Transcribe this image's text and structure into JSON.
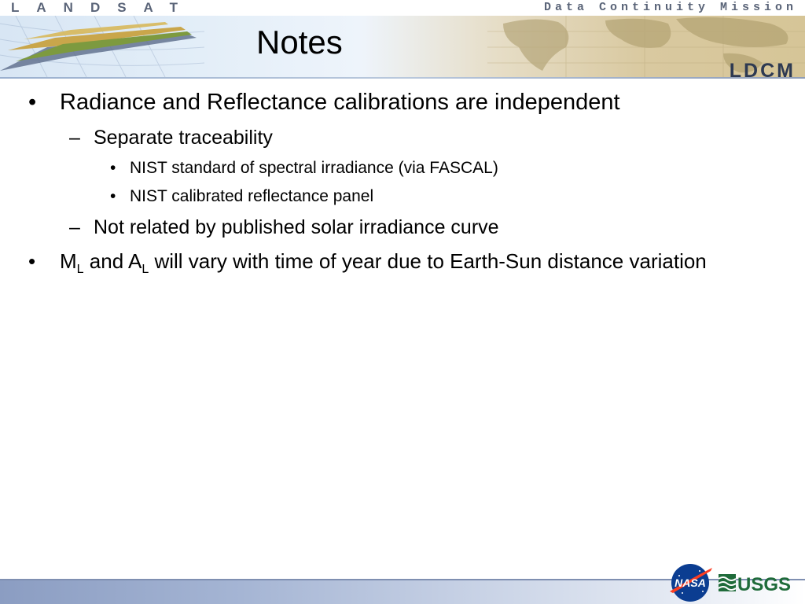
{
  "header": {
    "brand_left": "LANDSAT",
    "brand_right": "Data Continuity Mission",
    "program_logo_text": "LDCM"
  },
  "slide": {
    "title": "Notes",
    "items": [
      {
        "level": 1,
        "bullet": "•",
        "text": "Radiance and Reflectance calibrations are independent"
      },
      {
        "level": 2,
        "bullet": "–",
        "text": "Separate traceability"
      },
      {
        "level": 3,
        "bullet": "•",
        "text": "NIST standard of spectral irradiance (via FASCAL)"
      },
      {
        "level": 3,
        "bullet": "•",
        "text": "NIST calibrated reflectance panel"
      },
      {
        "level": 2,
        "bullet": "–",
        "text": "Not related by published solar irradiance curve"
      },
      {
        "level": 1,
        "bullet": "•",
        "parts": {
          "m": "M",
          "m_sub": "L",
          "and": " and A",
          "a_sub": "L",
          "rest": " will vary with time of year due to Earth-Sun distance variation"
        }
      }
    ]
  },
  "footer": {
    "logo_left": "NASA",
    "logo_right": "USGS"
  },
  "colors": {
    "brand_text": "#5a6478",
    "ldcm_text": "#2e3a52",
    "footer_start": "#8b9dc2",
    "nasa_blue": "#0b3d91",
    "nasa_red": "#fc3d21",
    "usgs_green": "#1f6b3a"
  }
}
